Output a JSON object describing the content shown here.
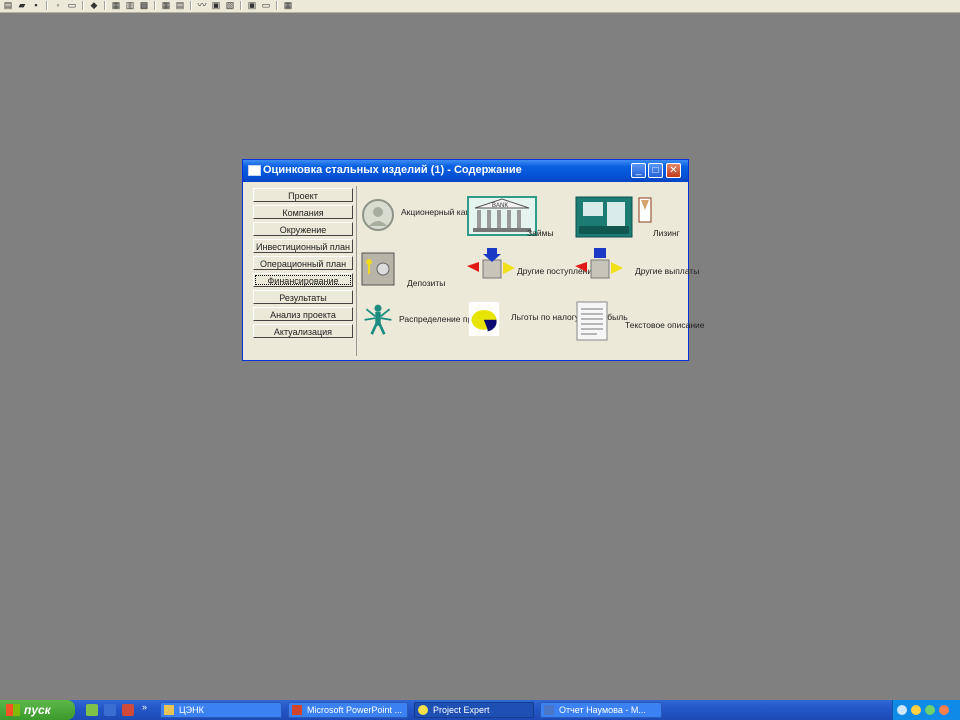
{
  "dialog": {
    "title": "Оцинковка стальных изделий (1) - Содержание",
    "controls": {
      "minimize": "_",
      "maximize": "□",
      "close": "✕"
    }
  },
  "nav": {
    "items": [
      {
        "label": "Проект"
      },
      {
        "label": "Компания"
      },
      {
        "label": "Окружение"
      },
      {
        "label": "Инвестиционный план"
      },
      {
        "label": "Операционный план"
      },
      {
        "label": "Финансирование",
        "active": true
      },
      {
        "label": "Результаты"
      },
      {
        "label": "Анализ проекта"
      },
      {
        "label": "Актуализация"
      }
    ]
  },
  "content": {
    "items": [
      {
        "label": "Акционерный капитал",
        "icon": "coin-portrait-icon"
      },
      {
        "label": "Займы",
        "icon": "bank-building-icon"
      },
      {
        "label": "Лизинг",
        "icon": "lease-machine-icon"
      },
      {
        "label": "Депозиты",
        "icon": "safe-keys-icon"
      },
      {
        "label": "Другие поступления",
        "icon": "inflow-arrows-icon"
      },
      {
        "label": "Другие выплаты",
        "icon": "outflow-arrows-icon"
      },
      {
        "label": "Распределение прибыли",
        "icon": "multi-arm-figure-icon"
      },
      {
        "label": "Льготы по налогу на прибыль",
        "icon": "pie-chart-icon"
      },
      {
        "label": "Текстовое описание",
        "icon": "text-document-icon"
      }
    ]
  },
  "taskbar": {
    "start_label": "пуск",
    "tasks": [
      {
        "label": "ЦЭНК"
      },
      {
        "label": "Microsoft PowerPoint ..."
      },
      {
        "label": "Project Expert",
        "active": true
      },
      {
        "label": "Отчет Наумова - M..."
      }
    ]
  },
  "colors": {
    "desktop": "#808080",
    "titlebar": "#0453d6",
    "taskbar": "#2457c8",
    "start": "#3c9a2c"
  }
}
